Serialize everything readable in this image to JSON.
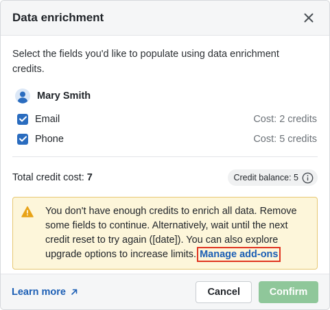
{
  "dialog": {
    "title": "Data enrichment",
    "close_icon": "close-icon"
  },
  "intro": "Select the fields you'd like to populate using data enrichment credits.",
  "person": {
    "name": "Mary Smith",
    "avatar_icon": "user-avatar-icon"
  },
  "fields": [
    {
      "label": "Email",
      "checked": true,
      "cost": "Cost: 2 credits"
    },
    {
      "label": "Phone",
      "checked": true,
      "cost": "Cost: 5 credits"
    }
  ],
  "total": {
    "label": "Total credit cost:",
    "value": "7"
  },
  "balance": {
    "label": "Credit balance: 5",
    "icon": "info-icon"
  },
  "warning": {
    "icon": "warning-triangle-icon",
    "text": "You don't have enough credits to enrich all data. Remove some fields to continue. Alternatively, wait until the next credit reset to try again ([date]). You can also explore upgrade options to increase limits. ",
    "link": "Manage add-ons"
  },
  "footer": {
    "learn_more": "Learn more",
    "learn_more_icon": "external-link-icon",
    "cancel": "Cancel",
    "confirm": "Confirm"
  },
  "colors": {
    "accent": "#2a6cbf",
    "link": "#1c5fb5",
    "warning_bg": "#fdf6da",
    "warning_border": "#e7c873",
    "warning_icon": "#e8a317",
    "confirm_disabled": "#8fc79a",
    "highlight_outline": "#e0331f"
  }
}
